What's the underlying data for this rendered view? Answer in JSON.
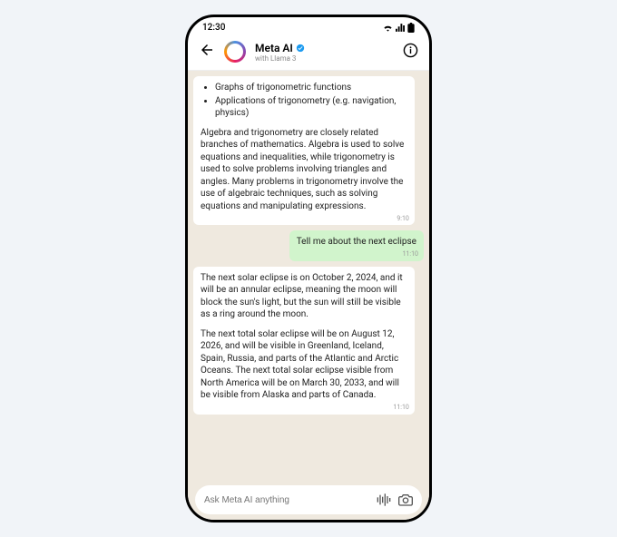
{
  "status": {
    "time": "12:30"
  },
  "header": {
    "title": "Meta AI",
    "subtitle": "with Llama 3"
  },
  "messages": {
    "m1": {
      "bullets": [
        "Graphs of trigonometric functions",
        "Applications of trigonometry (e.g. navigation, physics)"
      ],
      "para": "Algebra and trigonometry are closely related branches of mathematics. Algebra is used to solve equations and inequalities, while trigonometry is used to solve problems involving triangles and angles. Many problems in trigonometry involve the use of algebraic techniques, such as solving equations and manipulating expressions.",
      "time": "9:10"
    },
    "m2": {
      "text": "Tell me about the next eclipse",
      "time": "11:10"
    },
    "m3": {
      "para1": "The next solar eclipse is on October 2, 2024, and it will be an annular eclipse, meaning the moon will block the sun's light, but the sun will still be visible as a ring around the moon.",
      "para2": "The next total solar eclipse will be on August 12, 2026, and will be visible in Greenland, Iceland, Spain, Russia, and parts of the Atlantic and Arctic Oceans. The next total solar eclipse visible from North America will be on March 30, 2033, and will be visible from Alaska and parts of Canada.",
      "time": "11:10"
    }
  },
  "input": {
    "placeholder": "Ask Meta AI anything"
  }
}
